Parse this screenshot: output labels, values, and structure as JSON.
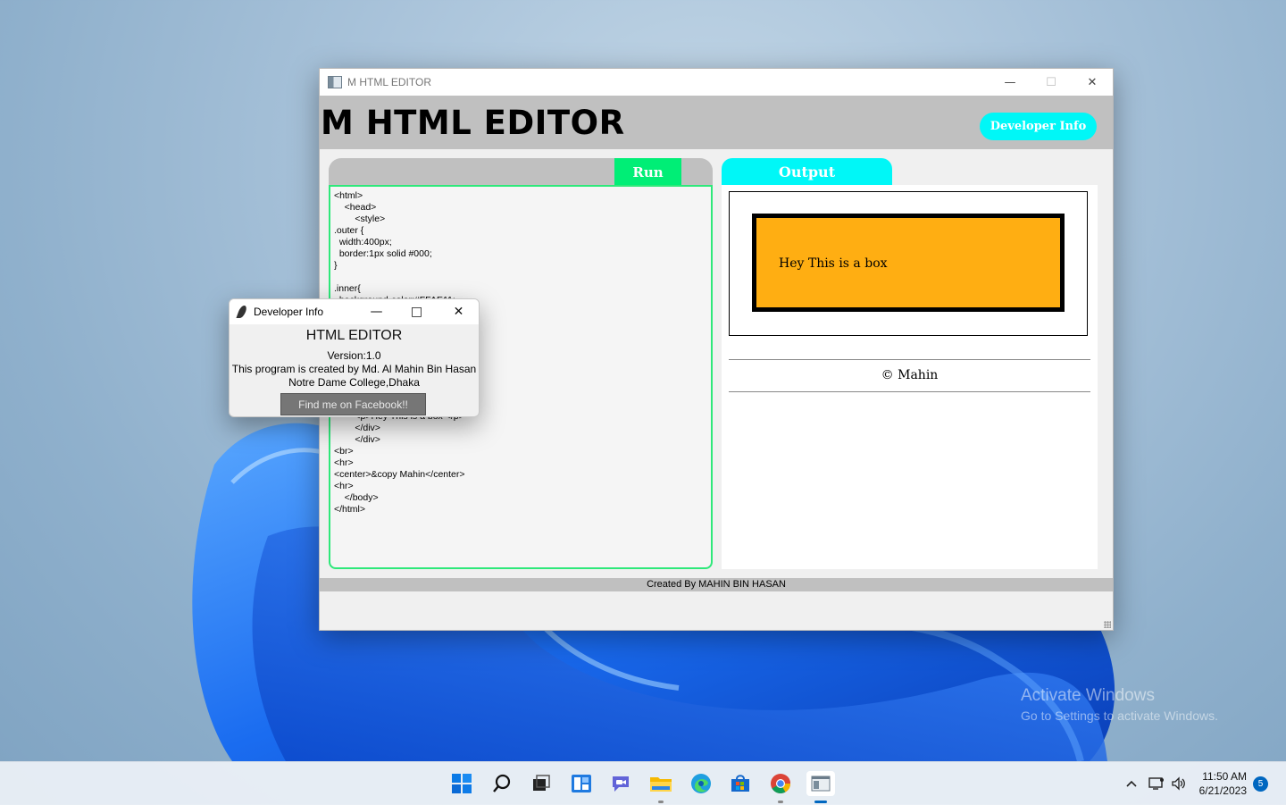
{
  "desktop": {
    "watermark_line1": "Activate Windows",
    "watermark_line2": "Go to Settings to activate Windows."
  },
  "main_window": {
    "title": "M HTML EDITOR",
    "header_title": "M HTML EDITOR",
    "developer_button": "Developer Info",
    "run_button": "Run",
    "output_tab": "Output",
    "code": "<html>\n    <head>\n        <style>\n.outer {\n  width:400px;\n  border:1px solid #000;\n}\n\n.inner{\n  background-color:#FFAE11;\n  width:350px;\n  height:100px;\n  border:4px solid #000;\n}\n        </style>\n    </head>\n    <body>\n        <div class=\"outer\">\n        <div class=\"inner\">\n        <p>Hey This is a box </p>\n        </div>\n        </div>\n<br>\n<hr>\n<center>&copy Mahin</center>\n<hr>\n    </body>\n</html>",
    "output_box_text": "Hey This is a box",
    "output_copyright": "© Mahin",
    "footer": "Created By MAHIN BIN HASAN",
    "output_box_color": "#FFAE11"
  },
  "dialog": {
    "title": "Developer Info",
    "heading": "HTML EDITOR",
    "version": "Version:1.0",
    "created_by": "This program is created by  Md. Al Mahin Bin Hasan",
    "college": "Notre Dame College,Dhaka",
    "facebook_button": "Find me on Facebook!!"
  },
  "taskbar": {
    "icons": [
      "start-icon",
      "search-icon",
      "task-view-icon",
      "widgets-icon",
      "chat-icon",
      "file-explorer-icon",
      "edge-icon",
      "store-icon",
      "chrome-icon",
      "html-editor-icon"
    ],
    "time": "11:50 AM",
    "date": "6/21/2023",
    "notification_count": "5"
  },
  "colors": {
    "accent_cyan": "#00F7F7",
    "run_green": "#00EE76",
    "header_gray": "#C0C0C0"
  }
}
